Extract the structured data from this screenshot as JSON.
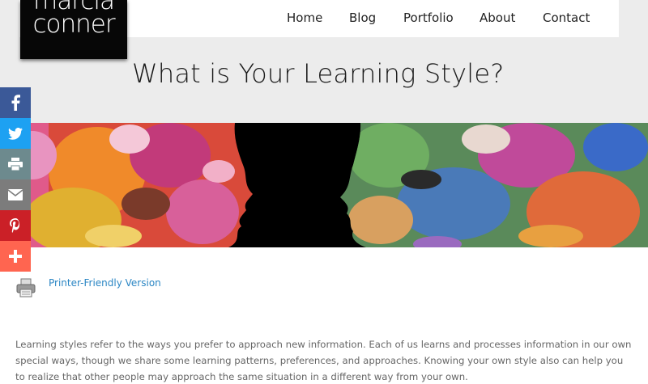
{
  "logo": {
    "line1": "marcia",
    "line2": "conner"
  },
  "nav": {
    "home": "Home",
    "blog": "Blog",
    "portfolio": "Portfolio",
    "about": "About",
    "contact": "Contact"
  },
  "page": {
    "title": "What is Your Learning Style?"
  },
  "hero": {
    "icon": "watercolor-faces-image"
  },
  "share": [
    {
      "icon": "facebook-icon",
      "color": "#3b5998"
    },
    {
      "icon": "twitter-icon",
      "color": "#1da1f2"
    },
    {
      "icon": "print-icon",
      "color": "#6d8a8e"
    },
    {
      "icon": "email-icon",
      "color": "#7c7c7c"
    },
    {
      "icon": "pinterest-icon",
      "color": "#cb2027"
    },
    {
      "icon": "plus-icon",
      "color": "#ff6550"
    }
  ],
  "printer": {
    "link": "Printer-Friendly Version",
    "icon": "printer-icon"
  },
  "body": {
    "paragraph": "Learning styles refer to the ways you prefer to approach new information. Each of us learns and processes information in our own special ways, though we share some learning patterns, preferences, and approaches. Knowing your own style also can help you to realize that other people may approach the same situation in a different way from your own."
  }
}
